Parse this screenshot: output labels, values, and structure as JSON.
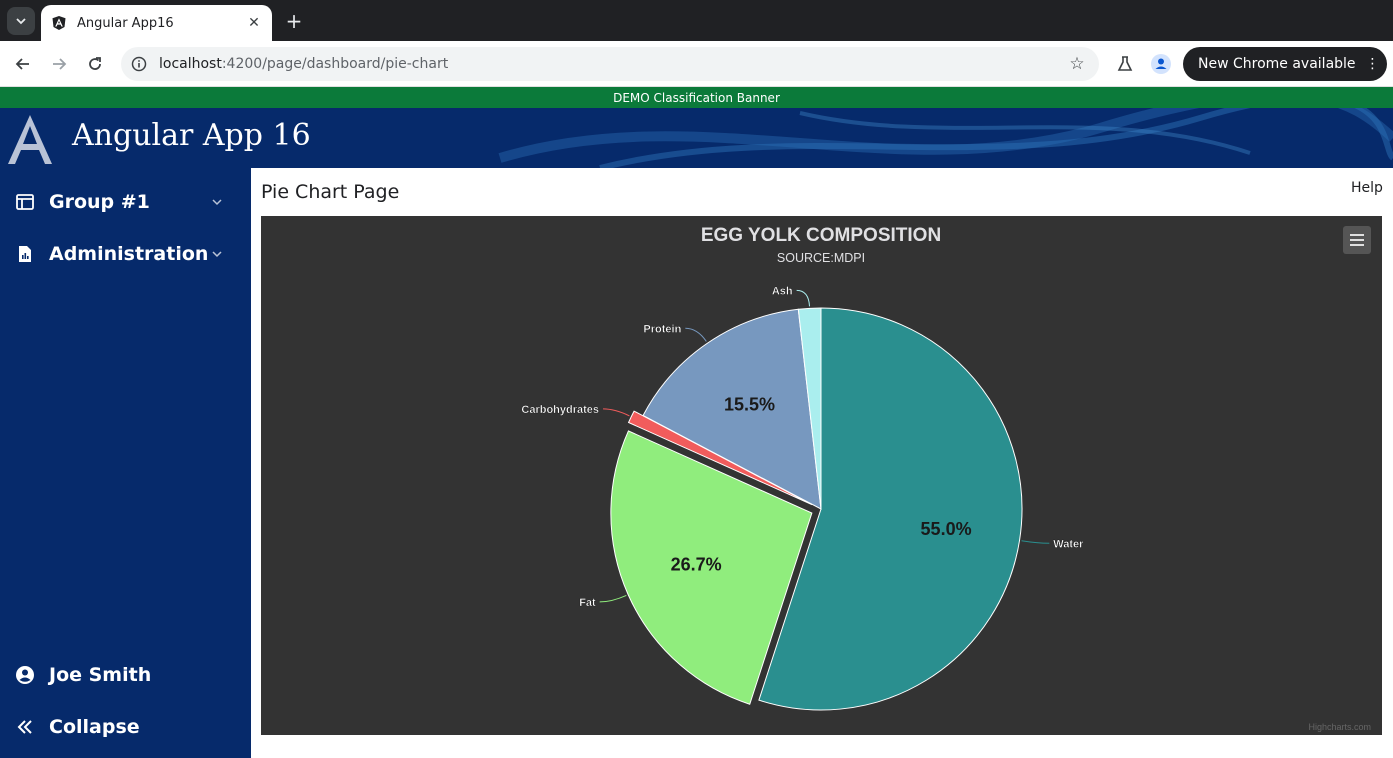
{
  "browser": {
    "tab_title": "Angular App16",
    "url_host": "localhost",
    "url_path": ":4200/page/dashboard/pie-chart",
    "new_chrome_label": "New Chrome available"
  },
  "banner": {
    "text": "DEMO Classification Banner"
  },
  "app": {
    "title": "Angular App 16"
  },
  "sidebar": {
    "items": [
      {
        "label": "Group #1",
        "icon": "dashboard-icon"
      },
      {
        "label": "Administration",
        "icon": "report-icon"
      }
    ],
    "user": {
      "label": "Joe Smith",
      "icon": "account-circle-icon"
    },
    "collapse": {
      "label": "Collapse",
      "icon": "double-chevron-left-icon"
    }
  },
  "page": {
    "title": "Pie Chart Page",
    "help": "Help"
  },
  "chart_data": {
    "type": "pie",
    "title": "EGG YOLK COMPOSITION",
    "subtitle": "SOURCE:MDPI",
    "credits": "Highcharts.com",
    "slices": [
      {
        "name": "Water",
        "value": 55.0,
        "label": "55.0%",
        "color": "#2a8f8f"
      },
      {
        "name": "Fat",
        "value": 26.7,
        "label": "26.7%",
        "color": "#90ed7d"
      },
      {
        "name": "Carbohydrates",
        "value": 1.0,
        "label": "",
        "color": "#f15c5c"
      },
      {
        "name": "Protein",
        "value": 15.5,
        "label": "15.5%",
        "color": "#7798bf"
      },
      {
        "name": "Ash",
        "value": 1.8,
        "label": "",
        "color": "#aaeeee"
      }
    ]
  },
  "colors": {
    "sidebar_bg": "#062a6b",
    "banner_bg": "#0b7a3a",
    "chart_bg": "#333333"
  }
}
